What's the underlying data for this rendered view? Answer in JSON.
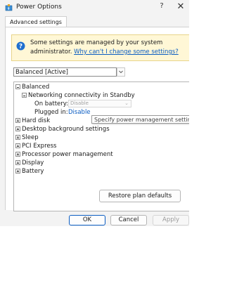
{
  "window": {
    "title": "Power Options",
    "app_icon": "power-options-icon",
    "help_label": "?",
    "close_label": "✕"
  },
  "tab": {
    "label": "Advanced settings"
  },
  "banner": {
    "icon": "shield-info-icon",
    "text": "Some settings are managed by your system administrator.",
    "link": "Why can't I change some settings?"
  },
  "plan": {
    "selected": "Balanced [Active]",
    "chevron": "⌄"
  },
  "tree": {
    "items": [
      {
        "label": "Balanced",
        "state": "expanded"
      },
      {
        "label": "Networking connectivity in Standby",
        "state": "expanded"
      },
      {
        "label": "On battery:",
        "value": "Disable"
      },
      {
        "label": "Plugged in:",
        "value": "Disable"
      },
      {
        "label": "Hard disk",
        "state": "collapsed"
      },
      {
        "label": "Desktop background settings",
        "state": "collapsed"
      },
      {
        "label": "Sleep",
        "state": "collapsed"
      },
      {
        "label": "PCI Express",
        "state": "collapsed"
      },
      {
        "label": "Processor power management",
        "state": "collapsed"
      },
      {
        "label": "Display",
        "state": "collapsed"
      },
      {
        "label": "Battery",
        "state": "collapsed"
      }
    ]
  },
  "tooltip": "Specify power management settings",
  "buttons": {
    "restore": "Restore plan defaults",
    "ok": "OK",
    "cancel": "Cancel",
    "apply": "Apply"
  },
  "colors": {
    "accent": "#0a5cc2",
    "banner_bg": "#fff7d6"
  }
}
